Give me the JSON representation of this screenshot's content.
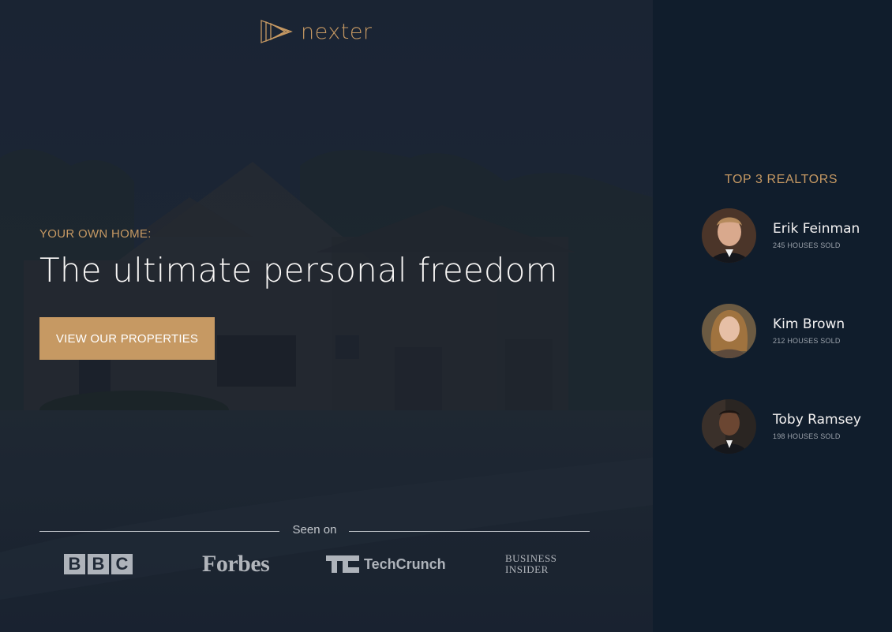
{
  "brand": {
    "name": "nexter",
    "logo_icon": "triangles-logo-icon"
  },
  "hero": {
    "eyebrow": "YOUR OWN HOME:",
    "headline": "The ultimate personal freedom",
    "cta_label": "VIEW OUR PROPERTIES"
  },
  "seen_on": {
    "label": "Seen on",
    "logos": [
      "BBC",
      "Forbes",
      "TechCrunch",
      "BUSINESS INSIDER"
    ],
    "bbc_letters": [
      "B",
      "B",
      "C"
    ],
    "forbes": "Forbes",
    "techcrunch": "TechCrunch",
    "business_insider_line1": "BUSINESS",
    "business_insider_line2": "INSIDER"
  },
  "sidebar": {
    "title": "TOP 3 REALTORS",
    "realtors": [
      {
        "name": "Erik Feinman",
        "sold": "245 HOUSES SOLD"
      },
      {
        "name": "Kim Brown",
        "sold": "212 HOUSES SOLD"
      },
      {
        "name": "Toby Ramsey",
        "sold": "198 HOUSES SOLD"
      }
    ]
  },
  "colors": {
    "accent": "#c69963",
    "sidebar_bg": "#101d2c",
    "hero_overlay": "#1b2535",
    "text_light": "#f9f7f6"
  }
}
